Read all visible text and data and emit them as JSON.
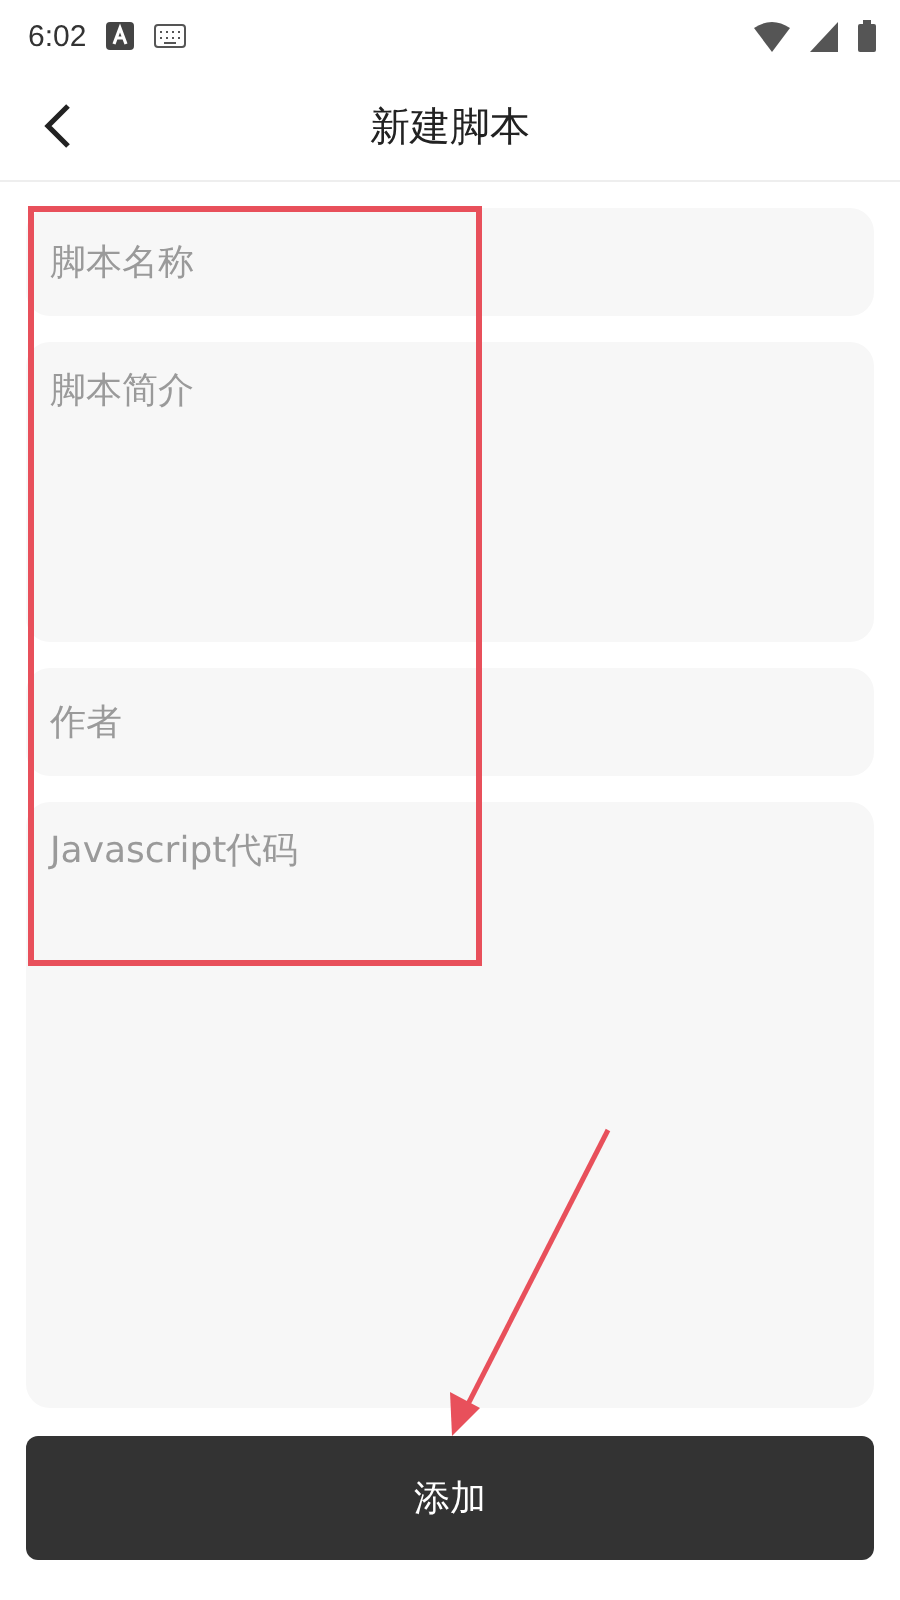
{
  "status_bar": {
    "time": "6:02"
  },
  "header": {
    "title": "新建脚本"
  },
  "fields": [
    {
      "kind": "line",
      "placeholder": "脚本名称"
    },
    {
      "kind": "area",
      "placeholder": "脚本简介"
    },
    {
      "kind": "line",
      "placeholder": "作者"
    },
    {
      "kind": "code",
      "placeholder": "Javascript代码"
    }
  ],
  "submit_button": {
    "label": "添加"
  }
}
